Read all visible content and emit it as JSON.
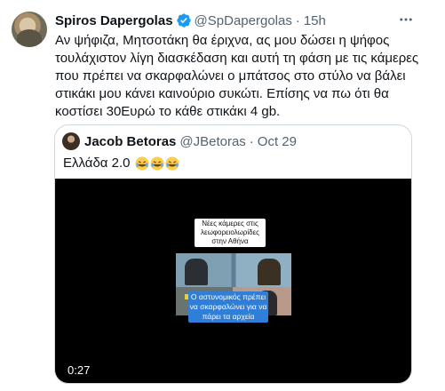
{
  "tweet": {
    "author_name": "Spiros Dapergolas",
    "handle": "@SpDapergolas",
    "separator": "·",
    "time": "15h",
    "text_lines": [
      "Αν ψήφιζα, Μητσοτάκη θα έριχνα, ας μου δώσει η ψήφος",
      "τουλάχιστον λίγη διασκέδαση και αυτή τη φάση με τις κάμερες",
      "που πρέπει να σκαρφαλώνει ο μπάτσος στο στύλο να βάλει",
      "στικάκι μου κάνει καινούριο συκώτι. Επίσης να πω ότι θα",
      "κοστίσει 30Ευρώ το κάθε στικάκι 4 gb."
    ],
    "verified_color": "#1d9bf0"
  },
  "quote": {
    "author_name": "Jacob Betoras",
    "handle": "@JBetoras",
    "separator": "·",
    "time": "Oct 29",
    "text": "Ελλάδα 2.0",
    "emojis": [
      "rolling-on-the-floor-laughing",
      "rolling-on-the-floor-laughing",
      "rolling-on-the-floor-laughing"
    ],
    "video": {
      "caption_top_lines": [
        "Νέες κάμερες στις",
        "λεωφορειολωρίδες",
        "στην Αθήνα"
      ],
      "caption_bottom_lines": [
        "Ο αστυνομικός πρέπει",
        "να σκαρφαλώνει για να",
        "πάρει τα αρχεία"
      ],
      "duration": "0:27"
    }
  }
}
